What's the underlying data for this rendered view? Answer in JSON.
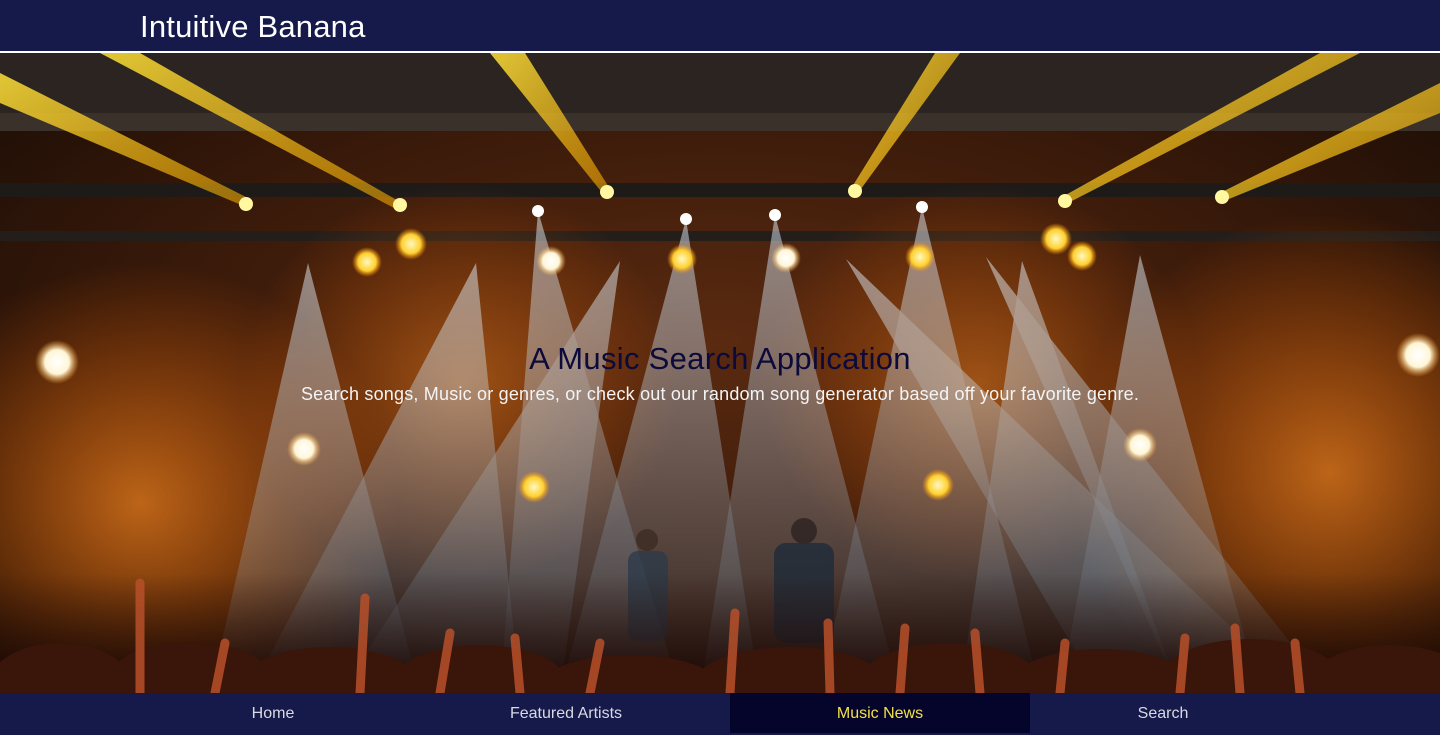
{
  "header": {
    "brand": "Intuitive Banana"
  },
  "hero": {
    "title": "A Music Search Application",
    "subtitle": "Search songs, Music or genres, or check out our random song generator based off your favorite genre.",
    "background_image": "concert-stage-lights-photo"
  },
  "nav": {
    "items": [
      {
        "label": "Home",
        "active": false
      },
      {
        "label": "Featured Artists",
        "active": false
      },
      {
        "label": "Music News",
        "active": true
      },
      {
        "label": "Search",
        "active": false
      }
    ]
  },
  "colors": {
    "navy": "#151a4a",
    "active_bg": "#05042a",
    "active_text": "#f2e14a",
    "title_text": "#0b0a3a"
  }
}
